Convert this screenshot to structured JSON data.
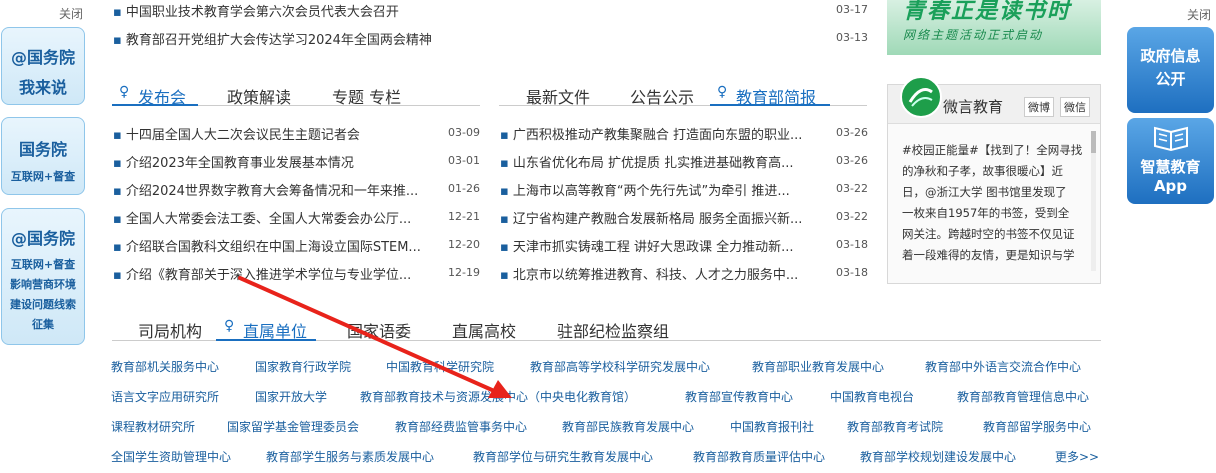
{
  "left_float": {
    "close": "关闭",
    "btn1": {
      "line1": "@国务院",
      "line2": "我来说"
    },
    "btn2": {
      "line1": "国务院",
      "line2": "互联网+督查"
    },
    "btn3": {
      "line1": "@国务院",
      "line2": "互联网+督查",
      "line3": "影响营商环境",
      "line4": "建设问题线索",
      "line5": "征集"
    }
  },
  "right_float": {
    "close": "关闭",
    "btn1": {
      "line1": "政府信息",
      "line2": "公开"
    },
    "btn2": {
      "line1": "智慧教育",
      "line2": "App"
    }
  },
  "top_news": [
    {
      "title": "中国职业技术教育学会第六次会员代表大会召开",
      "date": "03-17"
    },
    {
      "title": "教育部召开党组扩大会传达学习2024年全国两会精神",
      "date": "03-13"
    }
  ],
  "banner": {
    "line1": "青春正是读书时",
    "line2": "网络主题活动正式启动"
  },
  "left_tabs": [
    "发布会",
    "政策解读",
    "专题 专栏"
  ],
  "middle_tabs": [
    "最新文件",
    "公告公示",
    "教育部简报"
  ],
  "left_news": [
    {
      "title": "十四届全国人大二次会议民生主题记者会",
      "date": "03-09"
    },
    {
      "title": "介绍2023年全国教育事业发展基本情况",
      "date": "03-01"
    },
    {
      "title": "介绍2024世界数字教育大会筹备情况和一年来推...",
      "date": "01-26"
    },
    {
      "title": "全国人大常委会法工委、全国人大常委会办公厅...",
      "date": "12-21"
    },
    {
      "title": "介绍联合国教科文组织在中国上海设立国际STEM...",
      "date": "12-20"
    },
    {
      "title": "介绍《教育部关于深入推进学术学位与专业学位...",
      "date": "12-19"
    }
  ],
  "middle_news": [
    {
      "title": "广西积极推动产教集聚融合 打造面向东盟的职业...",
      "date": "03-26"
    },
    {
      "title": "山东省优化布局 扩优提质 扎实推进基础教育高...",
      "date": "03-26"
    },
    {
      "title": "上海市以高等教育“两个先行先试”为牵引 推进...",
      "date": "03-22"
    },
    {
      "title": "辽宁省构建产教融合发展新格局 服务全面振兴新...",
      "date": "03-22"
    },
    {
      "title": "天津市抓实铸魂工程 讲好大思政课 全力推动新...",
      "date": "03-18"
    },
    {
      "title": "北京市以统筹推进教育、科技、人才之力服务中...",
      "date": "03-18"
    }
  ],
  "weibo": {
    "title": "微言教育",
    "pill1": "微博",
    "pill2": "微信",
    "lines": [
      "#校园正能量#【找到了！全网寻找",
      "的净秋和子孝，故事很暖心】近",
      "日，@浙江大学 图书馆里发现了",
      "一枚来自1957年的书签，受到全",
      "网关注。跨越时空的书签不仅见证",
      "着一段难得的友情，更是知识与学"
    ]
  },
  "unit_tabs": [
    "司局机构",
    "直属单位",
    "国家语委",
    "直属高校",
    "驻部纪检监察组"
  ],
  "unit_rows": [
    [
      "教育部机关服务中心",
      "国家教育行政学院",
      "中国教育科学研究院",
      "教育部高等学校科学研究发展中心",
      "教育部职业教育发展中心",
      "教育部中外语言交流合作中心"
    ],
    [
      "语言文字应用研究所",
      "国家开放大学",
      "教育部教育技术与资源发展中心（中央电化教育馆）",
      "教育部宣传教育中心",
      "中国教育电视台",
      "教育部教育管理信息中心"
    ],
    [
      "课程教材研究所",
      "国家留学基金管理委员会",
      "教育部经费监管事务中心",
      "教育部民族教育发展中心",
      "中国教育报刊社",
      "教育部教育考试院",
      "教育部留学服务中心"
    ],
    [
      "全国学生资助管理中心",
      "教育部学生服务与素质发展中心",
      "教育部学位与研究生教育发展中心",
      "教育部教育质量评估中心",
      "教育部学校规划建设发展中心",
      "更多>>"
    ]
  ],
  "colors": {
    "accent": "#1a6fc0",
    "arrow": "#e8231b",
    "banner": "#2e9f5e"
  }
}
